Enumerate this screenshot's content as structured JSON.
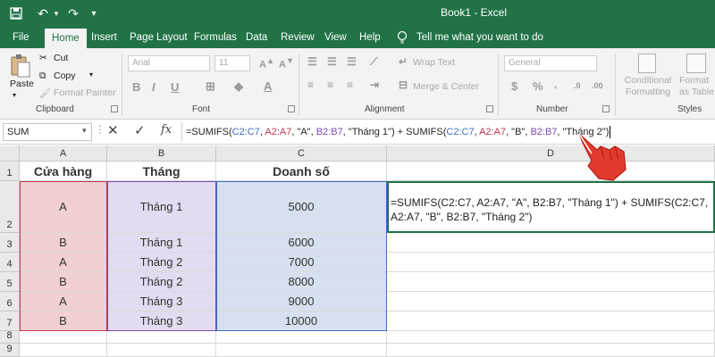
{
  "app": {
    "title": "Book1  -  Excel",
    "quick_access": [
      {
        "icon": "save-icon",
        "glyph": "🖫"
      },
      {
        "icon": "undo-icon",
        "glyph": "↶"
      },
      {
        "icon": "redo-icon",
        "glyph": "↷"
      },
      {
        "icon": "customize-dropdown-icon",
        "glyph": "▾"
      }
    ],
    "accent": "#217346"
  },
  "menu": {
    "tabs": [
      "File",
      "Home",
      "Insert",
      "Page Layout",
      "Formulas",
      "Data",
      "Review",
      "View",
      "Help"
    ],
    "active_tab": "Home",
    "tell_me": "Tell me what you want to do"
  },
  "ribbon": {
    "clipboard": {
      "paste": "Paste",
      "cut": "Cut",
      "copy": "Copy",
      "format_painter": "Format Painter",
      "label": "Clipboard"
    },
    "font": {
      "font_name": "Arial",
      "font_size": "11",
      "label": "Font"
    },
    "alignment": {
      "wrap_text": "Wrap Text",
      "merge_center": "Merge & Center",
      "label": "Alignment"
    },
    "number": {
      "format": "General",
      "label": "Number"
    },
    "styles": {
      "conditional_formatting": "Conditional Formatting",
      "format_as_table": "Format as Table",
      "label": "Styles"
    }
  },
  "formula_bar": {
    "name_box": "SUM",
    "fx": "fx",
    "formula_parts": [
      {
        "text": "=SUMIFS(",
        "cls": ""
      },
      {
        "text": "C2:C7",
        "cls": "r1"
      },
      {
        "text": ", ",
        "cls": ""
      },
      {
        "text": "A2:A7",
        "cls": "r2"
      },
      {
        "text": ", \"A\", ",
        "cls": ""
      },
      {
        "text": "B2:B7",
        "cls": "r3"
      },
      {
        "text": ", \"Tháng 1\") + SUMIFS(",
        "cls": ""
      },
      {
        "text": "C2:C7",
        "cls": "r1"
      },
      {
        "text": ", ",
        "cls": ""
      },
      {
        "text": "A2:A7",
        "cls": "r2"
      },
      {
        "text": ", \"B\", ",
        "cls": ""
      },
      {
        "text": "B2:B7",
        "cls": "r3"
      },
      {
        "text": ", \"Tháng 2\")",
        "cls": ""
      }
    ]
  },
  "sheet": {
    "columns": [
      "A",
      "B",
      "C",
      "D"
    ],
    "row_numbers": [
      "1",
      "2",
      "3",
      "4",
      "5",
      "6",
      "7",
      "8",
      "9"
    ],
    "headers": [
      "Cửa hàng",
      "Tháng",
      "Doanh số"
    ],
    "rows": [
      [
        "A",
        "Tháng 1",
        "5000"
      ],
      [
        "B",
        "Tháng 1",
        "6000"
      ],
      [
        "A",
        "Tháng 2",
        "7000"
      ],
      [
        "B",
        "Tháng 2",
        "8000"
      ],
      [
        "A",
        "Tháng 3",
        "9000"
      ],
      [
        "B",
        "Tháng 3",
        "10000"
      ]
    ],
    "d2_formula": "=SUMIFS(C2:C7, A2:A7, \"A\", B2:B7, \"Tháng 1\") + SUMIFS(C2:C7, A2:A7, \"B\", B2:B7, \"Tháng 2\")"
  }
}
